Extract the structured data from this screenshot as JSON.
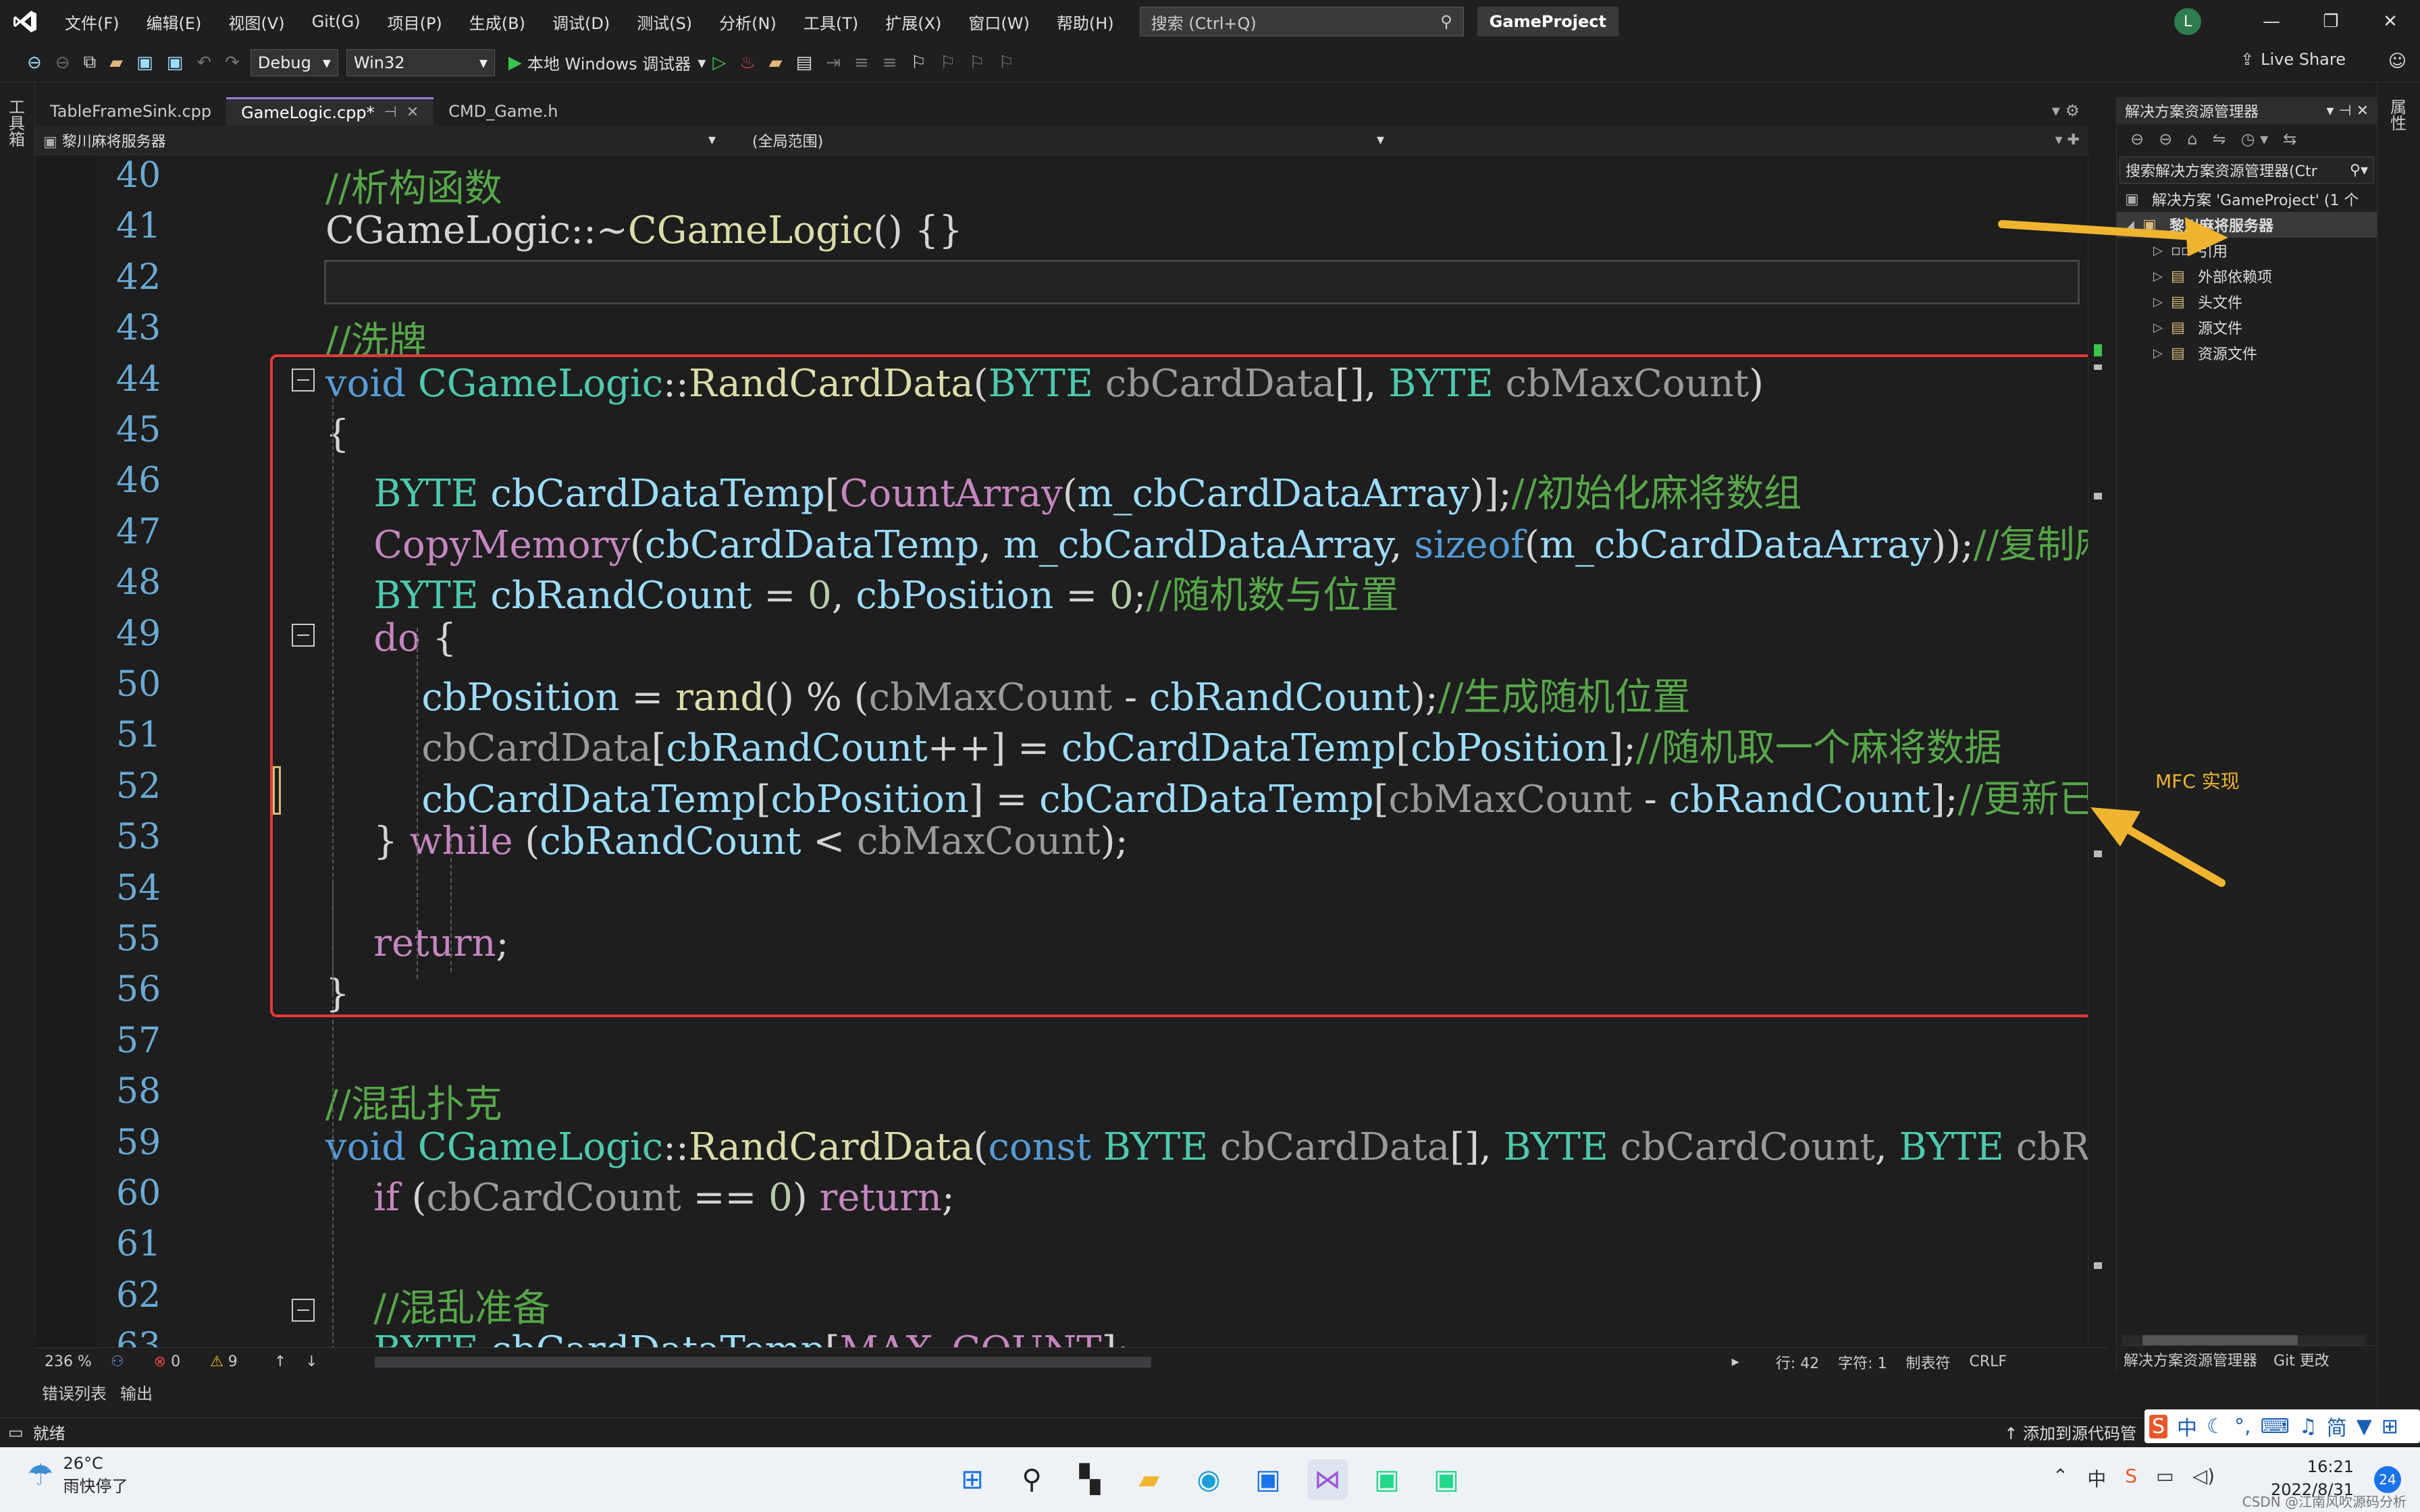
{
  "menu": [
    "文件(F)",
    "编辑(E)",
    "视图(V)",
    "Git(G)",
    "项目(P)",
    "生成(B)",
    "调试(D)",
    "测试(S)",
    "分析(N)",
    "工具(T)",
    "扩展(X)",
    "窗口(W)",
    "帮助(H)"
  ],
  "search_placeholder": "搜索 (Ctrl+Q)",
  "project_title": "GameProject",
  "user_initial": "L",
  "toolbar": {
    "config": "Debug",
    "platform": "Win32",
    "run_label": "本地 Windows 调试器",
    "live_share": "Live Share"
  },
  "left_strip_label": "工具箱",
  "right_strip_label": "属性",
  "tabs": [
    {
      "label": "TableFrameSink.cpp",
      "active": false
    },
    {
      "label": "GameLogic.cpp*",
      "active": true
    },
    {
      "label": "CMD_Game.h",
      "active": false
    }
  ],
  "nav": {
    "project": "黎川麻将服务器",
    "scope": "(全局范围)"
  },
  "code_lines": [
    {
      "n": "40",
      "html": "<span class='c'>//析构函数</span>"
    },
    {
      "n": "41",
      "html": "<span class='p'>CGameLogic::~</span><span class='f'>CGameLogic</span><span class='p'>() {}</span>"
    },
    {
      "n": "42",
      "html": ""
    },
    {
      "n": "43",
      "html": "<span class='c'>//洗牌</span>"
    },
    {
      "n": "44",
      "html": "<span class='k'>void</span> <span class='t'>CGameLogic</span><span class='p'>::</span><span class='f'>RandCardData</span><span class='p'>(</span><span class='t'>BYTE</span> <span class='g'>cbCardData</span><span class='p'>[], </span><span class='t'>BYTE</span> <span class='g'>cbMaxCount</span><span class='p'>)</span>"
    },
    {
      "n": "45",
      "html": "<span class='p'>{</span>"
    },
    {
      "n": "46",
      "html": "    <span class='t'>BYTE</span> <span class='v'>cbCardDataTemp</span><span class='p'>[</span><span class='m'>CountArray</span><span class='p'>(</span><span class='v'>m_cbCardDataArray</span><span class='p'>)];</span><span class='c'>//初始化麻将数组</span>"
    },
    {
      "n": "47",
      "html": "    <span class='m'>CopyMemory</span><span class='p'>(</span><span class='v'>cbCardDataTemp</span><span class='p'>, </span><span class='v'>m_cbCardDataArray</span><span class='p'>, </span><span class='k'>sizeof</span><span class='p'>(</span><span class='v'>m_cbCardDataArray</span><span class='p'>));</span><span class='c'>//复制麻</span>"
    },
    {
      "n": "48",
      "html": "    <span class='t'>BYTE</span> <span class='v'>cbRandCount</span> <span class='p'>= </span><span class='n'>0</span><span class='p'>, </span><span class='v'>cbPosition</span> <span class='p'>= </span><span class='n'>0</span><span class='p'>;</span><span class='c'>//随机数与位置</span>"
    },
    {
      "n": "49",
      "html": "    <span class='m'>do</span> <span class='p'>{</span>"
    },
    {
      "n": "50",
      "html": "        <span class='v'>cbPosition</span> <span class='p'>= </span><span class='f'>rand</span><span class='p'>() % (</span><span class='g'>cbMaxCount</span> <span class='p'>- </span><span class='v'>cbRandCount</span><span class='p'>);</span><span class='c'>//生成随机位置</span>"
    },
    {
      "n": "51",
      "html": "        <span class='g'>cbCardData</span><span class='p'>[</span><span class='v'>cbRandCount</span><span class='p'>++] = </span><span class='v'>cbCardDataTemp</span><span class='p'>[</span><span class='v'>cbPosition</span><span class='p'>];</span><span class='c'>//随机取一个麻将数据</span>"
    },
    {
      "n": "52",
      "html": "        <span class='v'>cbCardDataTemp</span><span class='p'>[</span><span class='v'>cbPosition</span><span class='p'>] = </span><span class='v'>cbCardDataTemp</span><span class='p'>[</span><span class='g'>cbMaxCount</span> <span class='p'>- </span><span class='v'>cbRandCount</span><span class='p'>];</span><span class='c'>//更新已</span>"
    },
    {
      "n": "53",
      "html": "    <span class='p'>} </span><span class='m'>while</span> <span class='p'>(</span><span class='v'>cbRandCount</span> <span class='p'>&lt; </span><span class='g'>cbMaxCount</span><span class='p'>);</span>"
    },
    {
      "n": "54",
      "html": ""
    },
    {
      "n": "55",
      "html": "    <span class='m'>return</span><span class='p'>;</span>"
    },
    {
      "n": "56",
      "html": "<span class='p'>}</span>"
    },
    {
      "n": "57",
      "html": ""
    },
    {
      "n": "58",
      "html": "<span class='c'>//混乱扑克</span>"
    },
    {
      "n": "59",
      "html": "<span class='k'>void</span> <span class='t'>CGameLogic</span><span class='p'>::</span><span class='f'>RandCardData</span><span class='p'>(</span><span class='k'>const</span> <span class='t'>BYTE</span> <span class='g'>cbCardData</span><span class='p'>[], </span><span class='t'>BYTE</span> <span class='g'>cbCardCount</span><span class='p'>, </span><span class='t'>BYTE</span> <span class='g'>cbRandD</span>"
    },
    {
      "n": "60",
      "html": "    <span class='m'>if</span> <span class='p'>(</span><span class='g'>cbCardCount</span> <span class='p'>== </span><span class='n'>0</span><span class='p'>) </span><span class='m'>return</span><span class='p'>;</span>"
    },
    {
      "n": "61",
      "html": ""
    },
    {
      "n": "62",
      "html": "    <span class='c'>//混乱准备</span>"
    },
    {
      "n": "63",
      "html": "    <span class='t'>BYTE</span> <span class='v'>cbCardDataTemp</span><span class='p'>[</span><span class='m'>MAX_COUNT</span><span class='p'>];</span>"
    }
  ],
  "editor_status": {
    "zoom": "236 %",
    "errors": "0",
    "warnings": "9",
    "line": "行: 42",
    "char": "字符: 1",
    "tabs_mode": "制表符",
    "eol": "CRLF"
  },
  "tool_tabs": [
    "错误列表",
    "输出"
  ],
  "status_bar": {
    "ready": "就绪",
    "add_source": "添加到源代码管"
  },
  "solution": {
    "title": "解决方案资源管理器",
    "search_placeholder": "搜索解决方案资源管理器(Ctr",
    "solution_node": "解决方案 'GameProject' (1 个",
    "project_node": "黎川麻将服务器",
    "children": [
      "引用",
      "外部依赖项",
      "头文件",
      "源文件",
      "资源文件"
    ],
    "bottom_tabs": [
      "解决方案资源管理器",
      "Git 更改"
    ]
  },
  "annotation": "MFC 实现",
  "taskbar": {
    "temp": "26°C",
    "weather": "雨快停了",
    "time": "16:21",
    "date": "2022/8/31",
    "notifications": "24",
    "ime": "中",
    "watermark": "CSDN @江南风吹源码分析"
  },
  "colors": {
    "accent": "#9c7bd1",
    "highlight_box": "#e63939",
    "arrow": "#f0b530"
  }
}
